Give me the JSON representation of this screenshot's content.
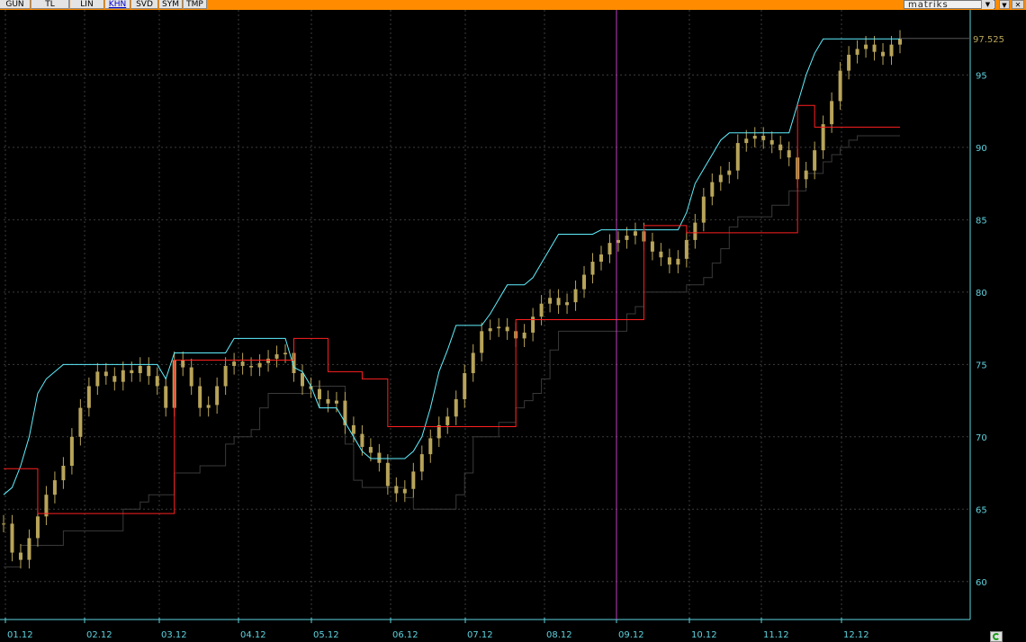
{
  "toolbar": {
    "buttons": [
      {
        "label": "GUN",
        "active": false
      },
      {
        "label": "TL",
        "active": false
      },
      {
        "label": "LIN",
        "active": false
      },
      {
        "label": "KHN",
        "active": true
      },
      {
        "label": "SVD",
        "active": false
      },
      {
        "label": "SYM",
        "active": false
      },
      {
        "label": "TMP",
        "active": false
      }
    ],
    "brand": "matriks"
  },
  "colors": {
    "background": "#000000",
    "toolbar": "#ff8c00",
    "axis": "#5fd3e0",
    "price": "#b8a45a",
    "upper_band": "#5ff0ff",
    "red_line": "#ff2020",
    "lower_band": "#3a3a3a",
    "cursor": "#c040c0",
    "last_price": "#b8a45a"
  },
  "icons": {
    "refresh": "refresh-icon"
  },
  "chart_data": {
    "type": "candlestick",
    "x_ticks": [
      "01.12",
      "02.12",
      "03.12",
      "04.12",
      "05.12",
      "06.12",
      "07.12",
      "08.12",
      "09.12",
      "10.12",
      "11.12",
      "12.12"
    ],
    "y_ticks": [
      60,
      65,
      70,
      75,
      80,
      85,
      90,
      95
    ],
    "ylim": [
      57.5,
      99.5
    ],
    "last_price": "97.525",
    "grid": true,
    "series": [
      {
        "role": "price",
        "close": [
          64,
          62,
          61.5,
          63,
          64.5,
          66,
          67,
          68,
          70,
          72,
          73.5,
          74.5,
          74.2,
          73.8,
          74.6,
          74.4,
          74.9,
          74.2,
          73.5,
          72,
          75.3,
          74.8,
          73.5,
          72,
          72.2,
          73.5,
          74.9,
          75.2,
          74.9,
          74.8,
          75.1,
          75.4,
          75.7,
          75.8,
          74.4,
          73.5,
          73.3,
          72.6,
          72.3,
          72.5,
          70.8,
          70.2,
          69.3,
          68.9,
          68.2,
          66.6,
          66.1,
          66.4,
          67.6,
          68.8,
          69.9,
          70.8,
          71.4,
          72.6,
          74.4,
          75.8,
          77.3,
          77.5,
          77.6,
          77.3,
          76.8,
          77.2,
          78.3,
          79.2,
          79.6,
          79.1,
          79.3,
          80.2,
          81.2,
          82.1,
          82.6,
          83.4,
          83.6,
          83.9,
          84.2,
          83.5,
          82.8,
          82.4,
          81.9,
          82.3,
          83.6,
          84.8,
          86.6,
          87.6,
          88.1,
          88.4,
          90.3,
          90.6,
          90.8,
          90.5,
          90.2,
          89.8,
          89.3,
          87.8,
          88.4,
          89.8,
          91.6,
          93.2,
          95.3,
          96.4,
          96.8,
          97.1,
          96.6,
          96.3,
          97.1,
          97.5
        ]
      },
      {
        "role": "upper_band",
        "values": [
          66,
          66.5,
          68,
          70,
          73,
          74,
          74.5,
          75,
          75,
          75,
          75,
          75,
          75,
          75,
          75,
          75,
          75,
          75,
          75,
          74,
          75.8,
          75.8,
          75.8,
          75.8,
          75.8,
          75.8,
          75.8,
          76.8,
          76.8,
          76.8,
          76.8,
          76.8,
          76.8,
          76.8,
          74.8,
          74.5,
          73.5,
          72,
          72,
          72,
          71,
          70,
          69,
          68.5,
          68.5,
          68.5,
          68.5,
          68.5,
          69,
          70,
          72,
          74.5,
          76,
          77.7,
          77.7,
          77.7,
          77.7,
          78.5,
          79.5,
          80.5,
          80.5,
          80.5,
          81,
          82,
          83,
          84,
          84,
          84,
          84,
          84,
          84.3,
          84.3,
          84.3,
          84.3,
          84.3,
          84.3,
          84.3,
          84.3,
          84.3,
          84.3,
          85.5,
          87.5,
          88.5,
          89.5,
          90.5,
          91,
          91,
          91,
          91,
          91,
          91,
          91,
          91,
          93,
          95,
          96.5,
          97.5,
          97.5,
          97.5,
          97.5,
          97.5,
          97.5,
          97.5,
          97.5,
          97.5,
          97.5
        ]
      },
      {
        "role": "red_line",
        "values": [
          67.8,
          67.8,
          67.8,
          67.8,
          64.7,
          64.7,
          64.7,
          64.7,
          64.7,
          64.7,
          64.7,
          64.7,
          64.7,
          64.7,
          64.7,
          64.7,
          64.7,
          64.7,
          64.7,
          64.7,
          75.3,
          75.3,
          75.3,
          75.3,
          75.3,
          75.3,
          75.3,
          75.3,
          75.3,
          75.3,
          75.3,
          75.3,
          75.3,
          75.3,
          76.8,
          76.8,
          76.8,
          76.8,
          74.5,
          74.5,
          74.5,
          74.5,
          74,
          74,
          74,
          70.7,
          70.7,
          70.7,
          70.7,
          70.7,
          70.7,
          70.7,
          70.7,
          70.7,
          70.7,
          70.7,
          70.7,
          70.7,
          70.7,
          70.7,
          78.1,
          78.1,
          78.1,
          78.1,
          78.1,
          78.1,
          78.1,
          78.1,
          78.1,
          78.1,
          78.1,
          78.1,
          78.1,
          78.1,
          78.1,
          84.6,
          84.6,
          84.6,
          84.6,
          84.6,
          84.1,
          84.1,
          84.1,
          84.1,
          84.1,
          84.1,
          84.1,
          84.1,
          84.1,
          84.1,
          84.1,
          84.1,
          84.1,
          92.9,
          92.9,
          91.4,
          91.4,
          91.4,
          91.4,
          91.4,
          91.4,
          91.4,
          91.4,
          91.4,
          91.4,
          91.4
        ]
      },
      {
        "role": "lower_band",
        "values": [
          61,
          61,
          62.5,
          62.5,
          62.5,
          62.5,
          62.5,
          63.5,
          63.5,
          63.5,
          63.5,
          63.5,
          63.5,
          63.5,
          65,
          65,
          65.5,
          66,
          66,
          66,
          67.5,
          67.5,
          67.5,
          68,
          68,
          68,
          69.5,
          70,
          70,
          70.5,
          72,
          73,
          73,
          73,
          73,
          73,
          73.5,
          73.5,
          73.5,
          73.5,
          69.5,
          67,
          66.5,
          66.5,
          66.5,
          66.5,
          66.5,
          65.8,
          65,
          65,
          65,
          65,
          65,
          66,
          67.5,
          70,
          70,
          70,
          71,
          71,
          72,
          72.5,
          73,
          74,
          76,
          77.3,
          77.3,
          77.3,
          77.3,
          77.3,
          77.3,
          77.3,
          77.3,
          78.5,
          79,
          80,
          80,
          80,
          80,
          80,
          80.5,
          80.5,
          81,
          82,
          83,
          84.5,
          85.2,
          85.2,
          85.2,
          85.2,
          86,
          86,
          87,
          87,
          88.2,
          88.2,
          89,
          89.5,
          90,
          90.5,
          90.8,
          90.8,
          90.8,
          90.8,
          90.8,
          90.8
        ]
      }
    ]
  }
}
